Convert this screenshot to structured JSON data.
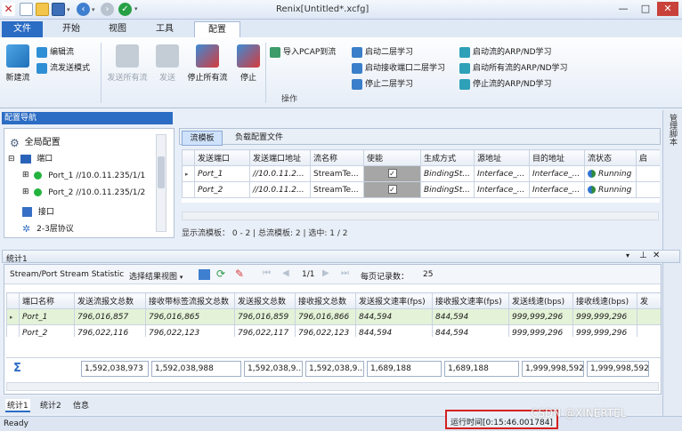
{
  "window": {
    "title": "Renix[Untitled*.xcfg]"
  },
  "colors": {
    "accent": "#2b6cc4",
    "highlight_row": "#e4f3d8",
    "red_box": "#d42020"
  },
  "tabs": [
    "文件",
    "开始",
    "视图",
    "工具",
    "配置"
  ],
  "ribbon": {
    "new_stream": "新建流",
    "edit_stream": "编辑流",
    "stream_send_mode": "流发送模式",
    "send_all": "发送所有流",
    "send": "发送",
    "stop_all": "停止所有流",
    "stop": "停止",
    "import_pcap": "导入PCAP到流",
    "start_l2": "启动二层学习",
    "start_rx_l2": "启动接收端口二层学习",
    "stop_l2": "停止二层学习",
    "start_arp_nd": "启动流的ARP/ND学习",
    "start_all_arp_nd": "启动所有流的ARP/ND学习",
    "stop_arp_nd": "停止流的ARP/ND学习",
    "group_label": "操作"
  },
  "nav": {
    "title": "配置导航",
    "global": "全局配置",
    "ports": "端口",
    "port1": "Port_1 //10.0.11.235/1/1",
    "port2": "Port_2 //10.0.11.235/1/2",
    "interface": "接口",
    "l23": "2-3层协议"
  },
  "stream_tabs": [
    "流模板",
    "负载配置文件"
  ],
  "stream_table": {
    "headers": [
      "发送端口",
      "发送端口地址",
      "流名称",
      "使能",
      "生成方式",
      "源地址",
      "目的地址",
      "流状态",
      "启"
    ],
    "rows": [
      [
        "Port_1",
        "//10.0.11.2...",
        "StreamTe...",
        "",
        "BindingSt...",
        "Interface_...",
        "Interface_...",
        "Running"
      ],
      [
        "Port_2",
        "//10.0.11.2...",
        "StreamTe...",
        "",
        "BindingSt...",
        "Interface_...",
        "Interface_...",
        "Running"
      ]
    ],
    "footer": "显示流模板： 0 - 2 | 总流模板: 2 | 选中: 1 / 2"
  },
  "right_strip": {
    "label": "管理脚本"
  },
  "stats": {
    "title": "统计1",
    "view_label": "Stream/Port Stream Statistic",
    "select_view": "选择结果视图",
    "page": "1/1",
    "per_page_label": "每页记录数：",
    "per_page": "25",
    "headers": [
      "端口名称",
      "发送流报文总数",
      "接收带标签流报文总数",
      "发送报文总数",
      "接收报文总数",
      "发送报文速率(fps)",
      "接收报文速率(fps)",
      "发送线速(bps)",
      "接收线速(bps)",
      "发"
    ],
    "rows": [
      [
        "Port_1",
        "796,016,857",
        "796,016,865",
        "796,016,859",
        "796,016,866",
        "844,594",
        "844,594",
        "999,999,296",
        "999,999,296"
      ],
      [
        "Port_2",
        "796,022,116",
        "796,022,123",
        "796,022,117",
        "796,022,123",
        "844,594",
        "844,594",
        "999,999,296",
        "999,999,296"
      ]
    ],
    "totals": [
      "1,592,038,973",
      "1,592,038,988",
      "1,592,038,9...",
      "1,592,038,9...",
      "1,689,188",
      "1,689,188",
      "1,999,998,592",
      "1,999,998,592"
    ],
    "sigma": "Σ"
  },
  "bottom_tabs": [
    "统计1",
    "统计2",
    "信息"
  ],
  "status": {
    "ready": "Ready",
    "runtime": "运行时间[0:15:46.001784]"
  },
  "watermark": "CSDN @XINERTEL"
}
